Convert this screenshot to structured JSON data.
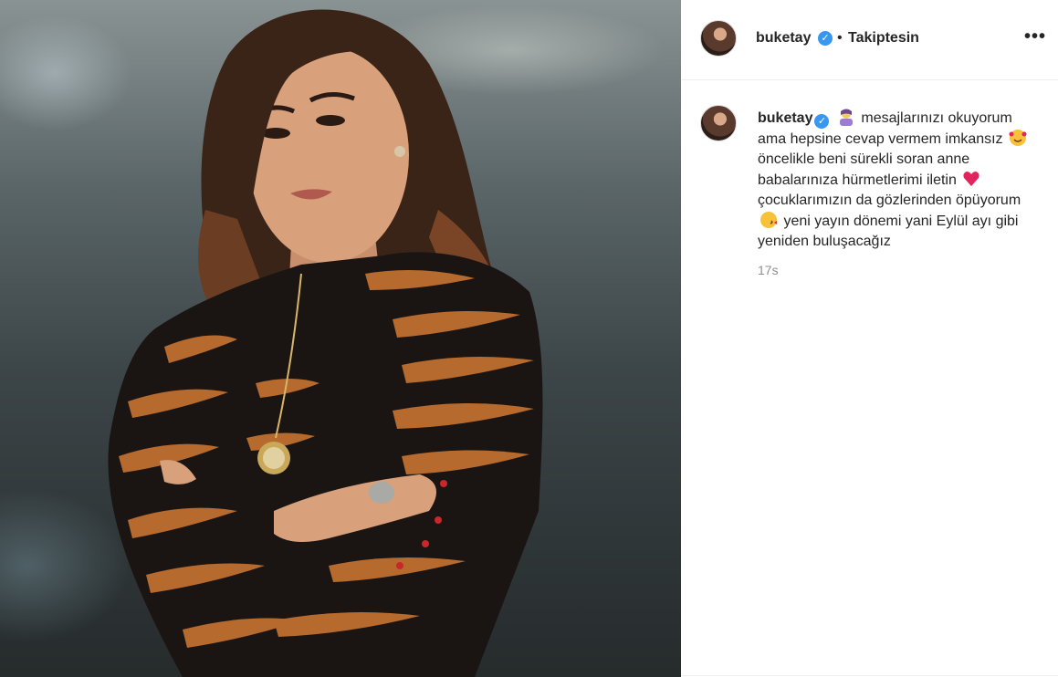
{
  "post": {
    "username": "buketay",
    "verified_icon": "verified-badge-icon",
    "separator": "•",
    "follow_status": "Takiptesin",
    "more_icon": "more-options-icon",
    "more_glyph": "•••"
  },
  "caption": {
    "username": "buketay",
    "segment_1": "mesajlarınızı okuyorum ama hepsine cevap vermem imkansız",
    "segment_2": "öncelikle beni sürekli soran anne babalarınıza hürmetlerimi iletin",
    "segment_3": "çocuklarımızın da gözlerinden öpüyorum",
    "segment_4": "yeni yayın dönemi yani Eylül ayı gibi yeniden buluşacağız",
    "emojis": [
      "woman-tipping-hand-emoji",
      "smiling-face-with-hearts-emoji",
      "red-heart-emoji",
      "face-blowing-kiss-emoji"
    ],
    "timestamp": "17s"
  },
  "colors": {
    "verified": "#3897f0",
    "text": "#262626",
    "muted": "#8e8e8e",
    "divider": "#efefef"
  }
}
